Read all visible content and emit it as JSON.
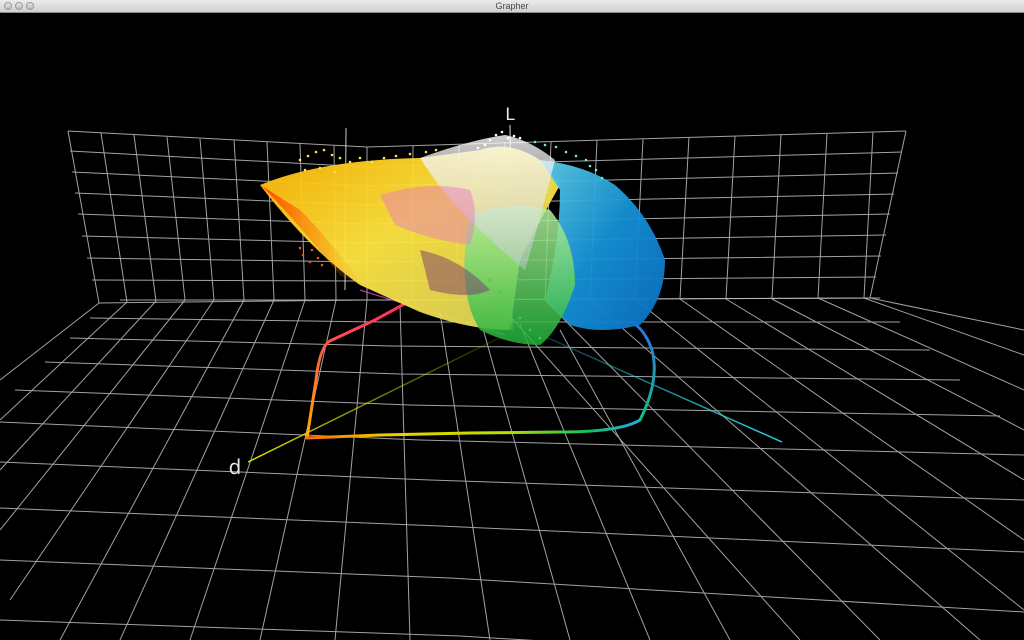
{
  "window": {
    "title": "Grapher"
  },
  "plot": {
    "axis_labels": {
      "vertical": "L",
      "front": "d"
    },
    "colors": {
      "background": "#000000",
      "grid": "#bfbfbf",
      "axis_d": "#e6e600",
      "axis_cyan": "#2cd6e6",
      "axis_l": "#e0e0e0"
    }
  }
}
